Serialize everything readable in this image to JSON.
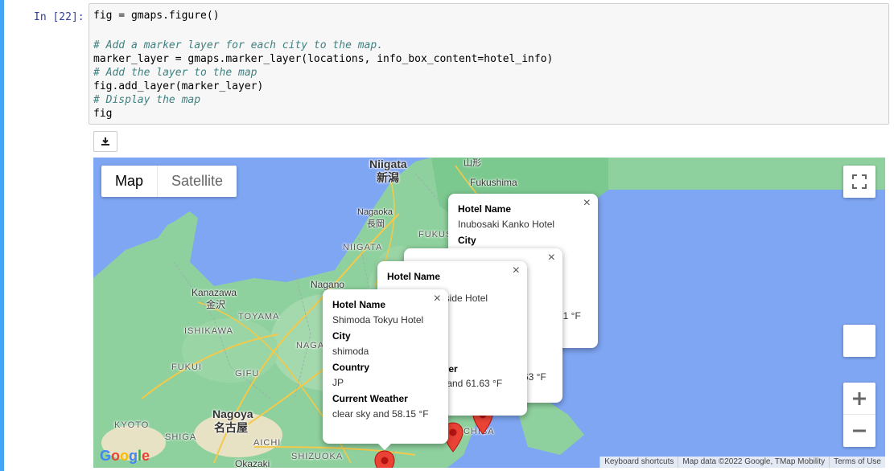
{
  "notebook": {
    "prompt": "In [22]:",
    "code_lines": [
      "fig = gmaps.figure()",
      "",
      "# Add a marker layer for each city to the map.",
      "marker_layer = gmaps.marker_layer(locations, info_box_content=hotel_info)",
      "# Add the layer to the map",
      "fig.add_layer(marker_layer)",
      "# Display the map",
      "fig"
    ],
    "download_icon": "download-icon"
  },
  "map": {
    "type_control": {
      "map_label": "Map",
      "satellite_label": "Satellite"
    },
    "labels": {
      "niigata_en": "Niigata",
      "niigata_jp": "新潟",
      "yamagata_jp": "山形",
      "fukushima": "Fukushima",
      "nagaoka_en": "Nagaoka",
      "nagaoka_jp": "長岡",
      "fukushima_region": "FUKUS",
      "niigata_region": "NIIGATA",
      "kanazawa_en": "Kanazawa",
      "kanazawa_jp": "金沢",
      "nagano": "Nagano",
      "toyama": "TOYAMA",
      "ishikawa": "ISHIKAWA",
      "naga": "NAGA",
      "fukui": "FUKUI",
      "gifu": "GIFU",
      "nagoya_en": "Nagoya",
      "nagoya_jp": "名古屋",
      "kyoto": "KYOTO",
      "shiga": "SHIGA",
      "aichi": "AICHI",
      "shizuoka": "SHIZUOKA",
      "okazaki": "Okazaki",
      "chiba": "CHIBA"
    },
    "info_windows": [
      {
        "hotel_name_label": "Hotel Name",
        "hotel_name": "Inubosaki Kanko Hotel",
        "city_label": "City",
        "temp_partial": "21 °F"
      },
      {
        "temp_partial": "63 °F"
      },
      {
        "hotel_name_label": "Hotel Name",
        "hotel_name_partial": "aside Hotel",
        "weather_label_partial": "ther",
        "weather_partial": "s and 61.63 °F"
      },
      {
        "hotel_name_label": "Hotel Name",
        "hotel_name": "Shimoda Tokyu Hotel",
        "city_label": "City",
        "city": "shimoda",
        "country_label": "Country",
        "country": "JP",
        "weather_label": "Current Weather",
        "weather": "clear sky and 58.15 °F"
      }
    ],
    "close_glyph": "×",
    "icons": [
      "fullscreen-icon",
      "zoom-in-icon",
      "zoom-out-icon",
      "close-icon",
      "map-marker-icon",
      "google-logo"
    ],
    "google_logo_text": "Google",
    "attribution": {
      "shortcuts": "Keyboard shortcuts",
      "data": "Map data ©2022 Google, TMap Mobility",
      "terms": "Terms of Use"
    },
    "colors": {
      "water": "#7fa6f3",
      "land": "#8fd19e",
      "marker": "#ea4335",
      "rail": "#42a5f5"
    }
  }
}
